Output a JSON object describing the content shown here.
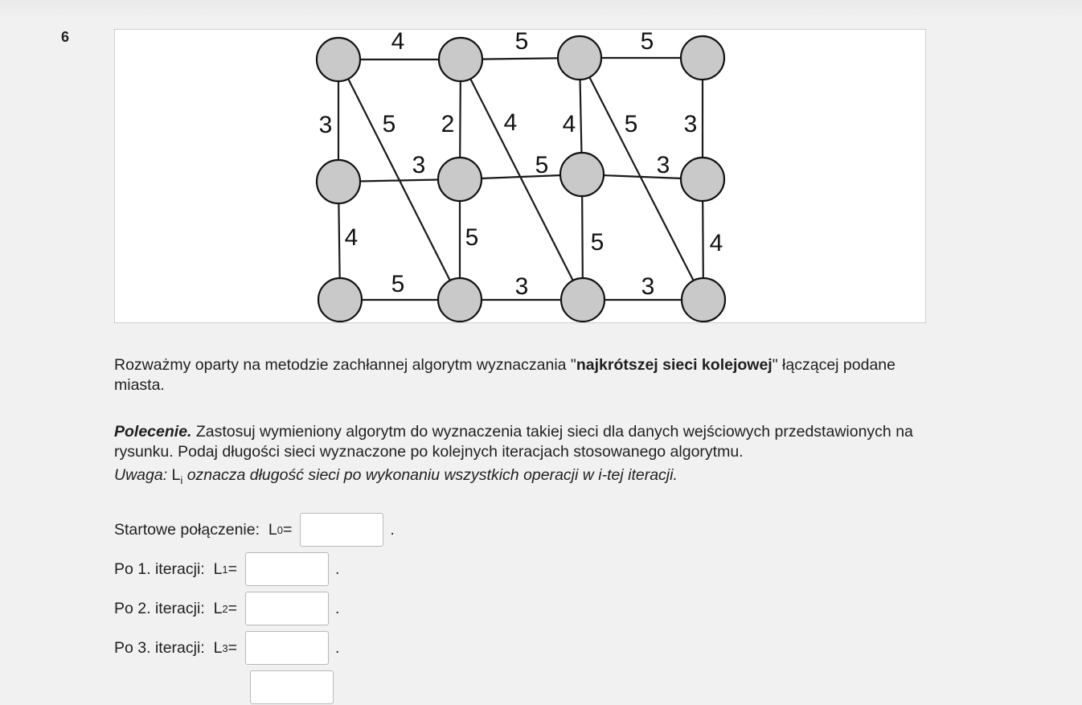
{
  "question_number": "6",
  "graph": {
    "nodes": [
      {
        "id": "n1"
      },
      {
        "id": "n2"
      },
      {
        "id": "n3"
      },
      {
        "id": "n4"
      },
      {
        "id": "n5"
      },
      {
        "id": "n6"
      },
      {
        "id": "n7"
      },
      {
        "id": "n8"
      },
      {
        "id": "n9"
      },
      {
        "id": "n10"
      },
      {
        "id": "n11"
      },
      {
        "id": "n12"
      }
    ],
    "edges": [
      {
        "from": "n1",
        "to": "n2",
        "weight": "4"
      },
      {
        "from": "n2",
        "to": "n3",
        "weight": "5"
      },
      {
        "from": "n3",
        "to": "n4",
        "weight": "5"
      },
      {
        "from": "n1",
        "to": "n5",
        "weight": "3"
      },
      {
        "from": "n1",
        "to": "n10",
        "weight": "5"
      },
      {
        "from": "n2",
        "to": "n6",
        "weight": "2"
      },
      {
        "from": "n2",
        "to": "n11",
        "weight": "4"
      },
      {
        "from": "n3",
        "to": "n7",
        "weight": "4"
      },
      {
        "from": "n3",
        "to": "n12",
        "weight": "5"
      },
      {
        "from": "n4",
        "to": "n8",
        "weight": "3"
      },
      {
        "from": "n5",
        "to": "n6",
        "weight": "3"
      },
      {
        "from": "n6",
        "to": "n7",
        "weight": "5"
      },
      {
        "from": "n7",
        "to": "n8",
        "weight": "3"
      },
      {
        "from": "n5",
        "to": "n9",
        "weight": "4"
      },
      {
        "from": "n6",
        "to": "n10",
        "weight": "5"
      },
      {
        "from": "n7",
        "to": "n11",
        "weight": "5"
      },
      {
        "from": "n8",
        "to": "n12",
        "weight": "4"
      },
      {
        "from": "n9",
        "to": "n10",
        "weight": "5"
      },
      {
        "from": "n10",
        "to": "n11",
        "weight": "3"
      },
      {
        "from": "n11",
        "to": "n12",
        "weight": "3"
      }
    ]
  },
  "intro": {
    "part1": "Rozważmy oparty na metodzie zachłannej algorytm wyznaczania \"",
    "bold": "najkrótszej sieci kolejowej",
    "part2": "\" łączącej podane miasta."
  },
  "task": {
    "label": "Polecenie.",
    "text": " Zastosuj wymieniony algorytm do wyznaczenia takiej sieci dla danych wejściowych przedstawionych na rysunku. Podaj długości sieci wyznaczone po kolejnych iteracjach stosowanego algorytmu."
  },
  "note": {
    "label": "Uwaga:",
    "symbol": " L",
    "sub": "i",
    "text": " oznacza długość sieci po wykonaniu wszystkich operacji w i-tej iteracji."
  },
  "answers": [
    {
      "label": "Startowe połączenie:  ",
      "var": "L",
      "sub": "0",
      "eq": " =",
      "value": "",
      "end": "."
    },
    {
      "label": "Po 1. iteracji:  ",
      "var": "L",
      "sub": "1",
      "eq": " =",
      "value": "",
      "end": "."
    },
    {
      "label": "Po 2. iteracji:  ",
      "var": "L",
      "sub": "2",
      "eq": " =",
      "value": "",
      "end": "."
    },
    {
      "label": "Po 3. iteracji:  ",
      "var": "L",
      "sub": "3",
      "eq": " =",
      "value": "",
      "end": "."
    }
  ]
}
